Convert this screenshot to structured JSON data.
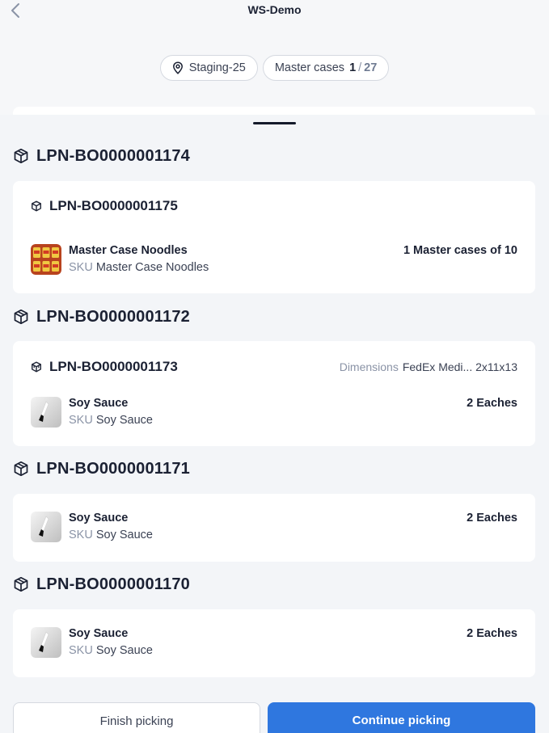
{
  "header": {
    "title": "WS-Demo",
    "location": "Staging-25",
    "master_cases_label": "Master cases",
    "master_cases_done": "1",
    "master_cases_separator": "/",
    "master_cases_total": "27"
  },
  "groups": [
    {
      "lpn": "LPN-BO0000001174",
      "card": {
        "lpn": "LPN-BO0000001175",
        "item": {
          "name": "Master Case Noodles",
          "sku_label": "SKU",
          "sku": "Master Case Noodles",
          "qty": "1 Master cases of 10",
          "thumb_icon": "noodles-image"
        }
      }
    },
    {
      "lpn": "LPN-BO0000001172",
      "card": {
        "lpn": "LPN-BO0000001173",
        "dimensions_label": "Dimensions",
        "dimensions_value": "FedEx Medi... 2x11x13",
        "item": {
          "name": "Soy Sauce",
          "sku_label": "SKU",
          "sku": "Soy Sauce",
          "qty": "2 Eaches",
          "thumb_icon": "soy-sauce-image"
        }
      }
    },
    {
      "lpn": "LPN-BO0000001171",
      "card": {
        "item": {
          "name": "Soy Sauce",
          "sku_label": "SKU",
          "sku": "Soy Sauce",
          "qty": "2 Eaches",
          "thumb_icon": "soy-sauce-image"
        }
      }
    },
    {
      "lpn": "LPN-BO0000001170",
      "card": {
        "item": {
          "name": "Soy Sauce",
          "sku_label": "SKU",
          "sku": "Soy Sauce",
          "qty": "2 Eaches",
          "thumb_icon": "soy-sauce-image"
        }
      }
    }
  ],
  "actions": {
    "finish": "Finish picking",
    "continue": "Continue picking"
  },
  "colors": {
    "primary": "#2f77df",
    "text": "#1b2133",
    "muted": "#8a93a6",
    "background": "#f3f5f8"
  }
}
